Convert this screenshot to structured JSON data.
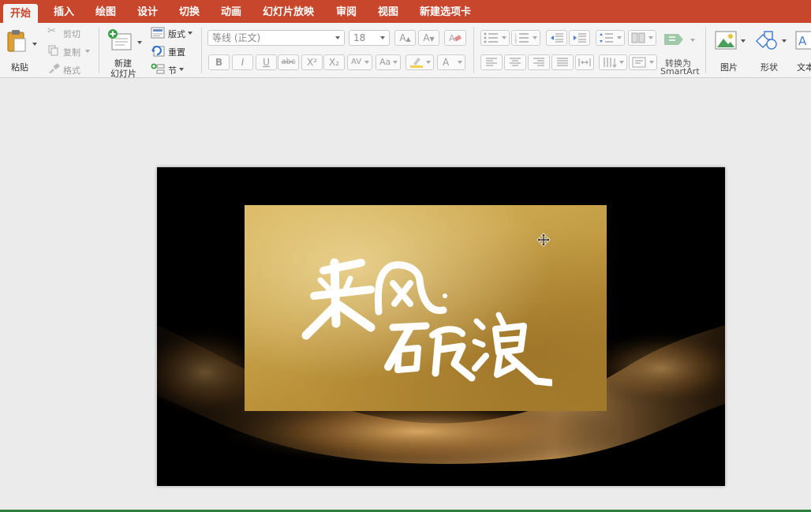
{
  "tabs": [
    "开始",
    "插入",
    "绘图",
    "设计",
    "切换",
    "动画",
    "幻灯片放映",
    "审阅",
    "视图",
    "新建选项卡"
  ],
  "clipboard": {
    "paste": "粘贴",
    "cut": "剪切",
    "copy": "复制",
    "format": "格式"
  },
  "slides": {
    "new_slide_line1": "新建",
    "new_slide_line2": "幻灯片",
    "layout": "版式",
    "reset": "重置",
    "section": "节"
  },
  "font": {
    "name": "等线 (正文)",
    "size": "18",
    "grow": "A",
    "shrink": "A",
    "bold": "B",
    "italic": "I",
    "underline": "U",
    "strike": "abc",
    "superscript": "X²",
    "subscript": "X₂",
    "spacing": "AV",
    "case": "Aa",
    "color": "A"
  },
  "paragraph": {
    "smartart_line1": "转换为",
    "smartart_line2": "SmartArt"
  },
  "insert": {
    "picture": "图片",
    "shape": "形状",
    "textbox": "文本"
  },
  "slide_content": {
    "calligraphy_text": "乘风破浪"
  },
  "colors": {
    "accent": "#c8462b",
    "gold": "#c9a44c"
  }
}
